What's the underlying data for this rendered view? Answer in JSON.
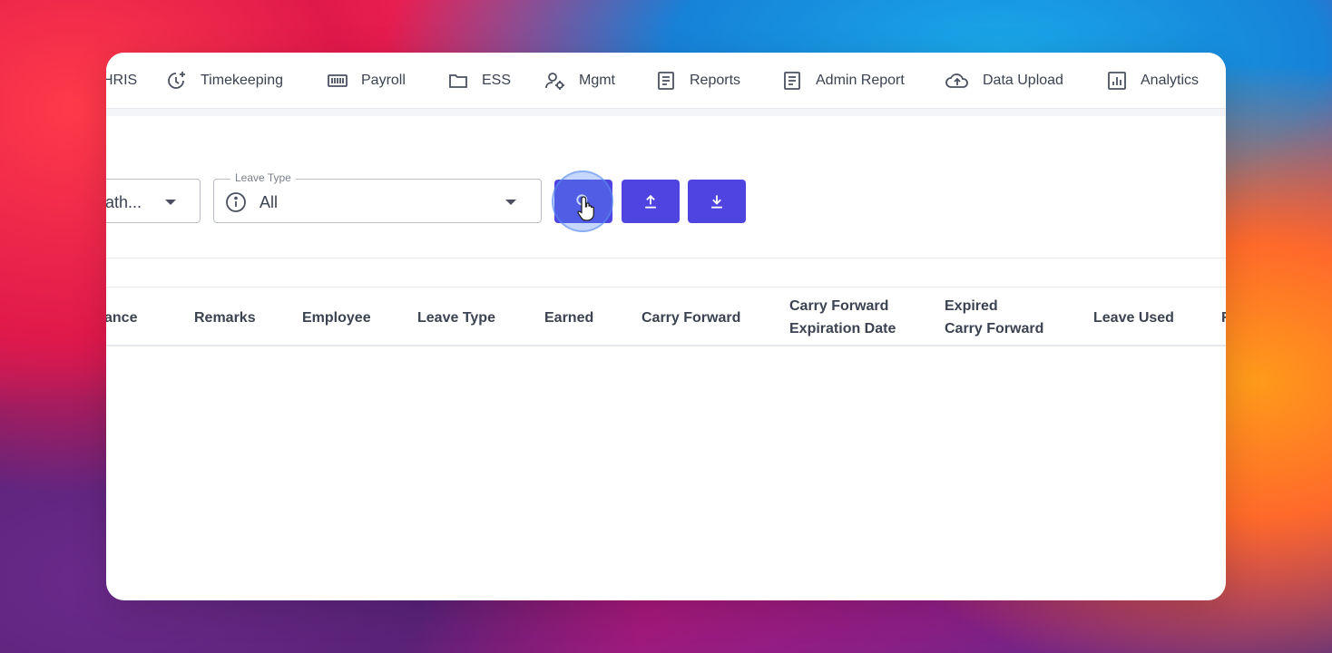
{
  "nav": {
    "items": [
      {
        "label": "HRIS",
        "icon": "none"
      },
      {
        "label": "Timekeeping",
        "icon": "clock-plus-icon"
      },
      {
        "label": "Payroll",
        "icon": "payroll-icon"
      },
      {
        "label": "ESS",
        "icon": "folder-icon"
      },
      {
        "label": "Mgmt",
        "icon": "user-gear-icon"
      },
      {
        "label": "Reports",
        "icon": "document-icon"
      },
      {
        "label": "Admin Report",
        "icon": "document-icon"
      },
      {
        "label": "Data Upload",
        "icon": "cloud-upload-icon"
      },
      {
        "label": "Analytics",
        "icon": "bar-chart-icon"
      }
    ]
  },
  "filters": {
    "first_select": {
      "value": "ath..."
    },
    "leave_type": {
      "legend": "Leave Type",
      "value": "All"
    }
  },
  "actions": {
    "search": "search-icon",
    "upload": "upload-icon",
    "download": "download-icon"
  },
  "table": {
    "columns": [
      {
        "line1": "ance",
        "line2": ""
      },
      {
        "line1": "Remarks",
        "line2": ""
      },
      {
        "line1": "Employee",
        "line2": ""
      },
      {
        "line1": "Leave Type",
        "line2": ""
      },
      {
        "line1": "Earned",
        "line2": ""
      },
      {
        "line1": "Carry Forward",
        "line2": ""
      },
      {
        "line1": "Carry Forward",
        "line2": "Expiration Date"
      },
      {
        "line1": "Expired",
        "line2": "Carry Forward"
      },
      {
        "line1": "Leave Used",
        "line2": ""
      },
      {
        "line1": "R",
        "line2": ""
      }
    ]
  },
  "colors": {
    "accent": "#4f44e0",
    "text": "#3b4250",
    "border": "#b9bec7"
  }
}
